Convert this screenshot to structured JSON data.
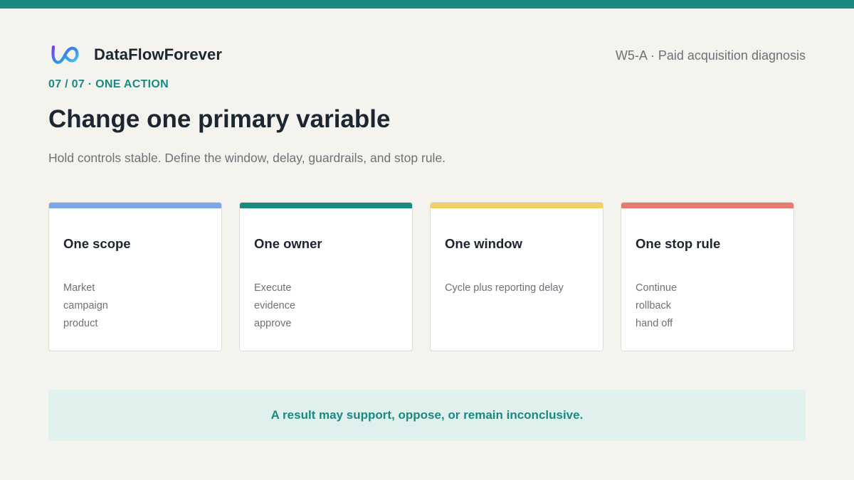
{
  "brand": {
    "name": "DataFlowForever",
    "logo_icon": "infinity-loop-icon",
    "logo_colors": [
      "#7b3fe4",
      "#2f8fe8",
      "#49c6f0"
    ]
  },
  "header": {
    "deck_ref": "W5-A · Paid acquisition diagnosis"
  },
  "slide": {
    "kicker": "07 / 07 · ONE ACTION",
    "title": "Change one primary variable",
    "subtitle": "Hold controls stable. Define the window, delay, guardrails, and stop rule."
  },
  "cards": [
    {
      "title": "One scope",
      "accent": "#7ea6ec",
      "lines": [
        "Market",
        "campaign",
        "product"
      ]
    },
    {
      "title": "One owner",
      "accent": "#1a8a80",
      "lines": [
        "Execute",
        "evidence",
        "approve"
      ]
    },
    {
      "title": "One window",
      "accent": "#f0d064",
      "lines": [
        "Cycle plus reporting delay"
      ]
    },
    {
      "title": "One stop rule",
      "accent": "#e67a6e",
      "lines": [
        "Continue",
        "rollback",
        "hand off"
      ]
    }
  ],
  "callout": {
    "text": "A result may support, oppose, or remain inconclusive."
  },
  "colors": {
    "accent": "#1a8a80",
    "background": "#f4f3ee",
    "callout_background": "#e0f1ed"
  }
}
